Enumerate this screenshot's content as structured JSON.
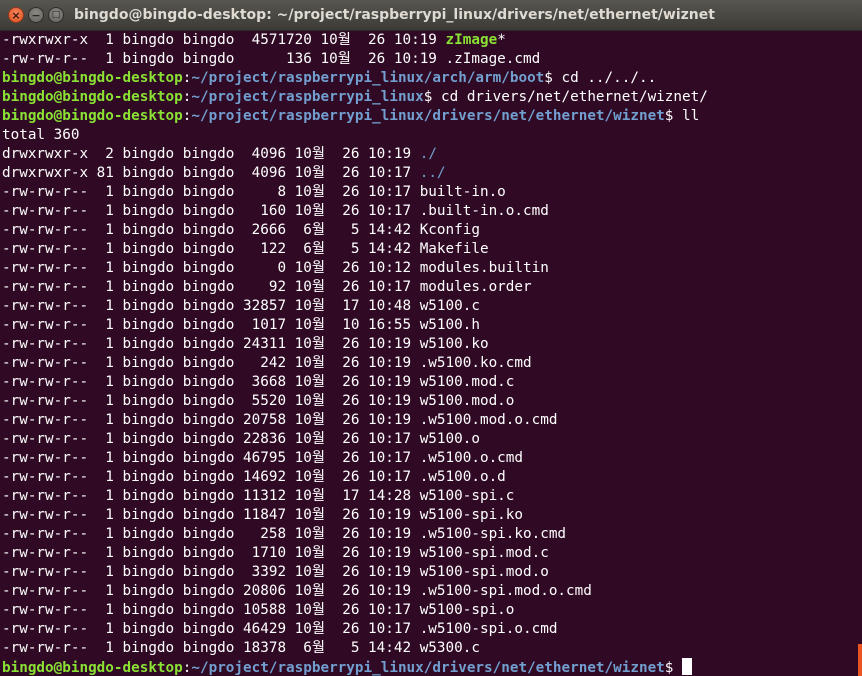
{
  "window": {
    "title": "bingdo@bingdo-desktop: ~/project/raspberrypi_linux/drivers/net/ethernet/wiznet",
    "close_glyph": "×",
    "min_glyph": "−",
    "max_glyph": "□"
  },
  "colors": {
    "background": "#300a24",
    "prompt_user": "#8ae234",
    "prompt_path": "#729fcf",
    "text": "#ffffff",
    "close_button": "#e0531f"
  },
  "terminal": {
    "lines": [
      [
        {
          "t": "-rwxrwxr-x  1 bingdo bingdo  4571720 10월  26 10:19 ",
          "c": "plain"
        },
        {
          "t": "zImage",
          "c": "exec"
        },
        {
          "t": "*",
          "c": "plain"
        }
      ],
      [
        {
          "t": "-rw-rw-r--  1 bingdo bingdo      136 10월  26 10:19 .zImage.cmd",
          "c": "plain"
        }
      ],
      [
        {
          "t": "bingdo@bingdo-desktop",
          "c": "user"
        },
        {
          "t": ":",
          "c": "plain"
        },
        {
          "t": "~/project/raspberrypi_linux/arch/arm/boot",
          "c": "path"
        },
        {
          "t": "$ cd ../../..",
          "c": "plain"
        }
      ],
      [
        {
          "t": "bingdo@bingdo-desktop",
          "c": "user"
        },
        {
          "t": ":",
          "c": "plain"
        },
        {
          "t": "~/project/raspberrypi_linux",
          "c": "path"
        },
        {
          "t": "$ cd drivers/net/ethernet/wiznet/",
          "c": "plain"
        }
      ],
      [
        {
          "t": "bingdo@bingdo-desktop",
          "c": "user"
        },
        {
          "t": ":",
          "c": "plain"
        },
        {
          "t": "~/project/raspberrypi_linux/drivers/net/ethernet/wiznet",
          "c": "path"
        },
        {
          "t": "$ ll",
          "c": "plain"
        }
      ],
      [
        {
          "t": "total 360",
          "c": "plain"
        }
      ],
      [
        {
          "t": "drwxrwxr-x  2 bingdo bingdo  4096 10월  26 10:19 ",
          "c": "plain"
        },
        {
          "t": "./",
          "c": "dir"
        }
      ],
      [
        {
          "t": "drwxrwxr-x 81 bingdo bingdo  4096 10월  26 10:17 ",
          "c": "plain"
        },
        {
          "t": "../",
          "c": "dir"
        }
      ],
      [
        {
          "t": "-rw-rw-r--  1 bingdo bingdo     8 10월  26 10:17 built-in.o",
          "c": "plain"
        }
      ],
      [
        {
          "t": "-rw-rw-r--  1 bingdo bingdo   160 10월  26 10:17 .built-in.o.cmd",
          "c": "plain"
        }
      ],
      [
        {
          "t": "-rw-rw-r--  1 bingdo bingdo  2666  6월   5 14:42 Kconfig",
          "c": "plain"
        }
      ],
      [
        {
          "t": "-rw-rw-r--  1 bingdo bingdo   122  6월   5 14:42 Makefile",
          "c": "plain"
        }
      ],
      [
        {
          "t": "-rw-rw-r--  1 bingdo bingdo     0 10월  26 10:12 modules.builtin",
          "c": "plain"
        }
      ],
      [
        {
          "t": "-rw-rw-r--  1 bingdo bingdo    92 10월  26 10:17 modules.order",
          "c": "plain"
        }
      ],
      [
        {
          "t": "-rw-rw-r--  1 bingdo bingdo 32857 10월  17 10:48 w5100.c",
          "c": "plain"
        }
      ],
      [
        {
          "t": "-rw-rw-r--  1 bingdo bingdo  1017 10월  10 16:55 w5100.h",
          "c": "plain"
        }
      ],
      [
        {
          "t": "-rw-rw-r--  1 bingdo bingdo 24311 10월  26 10:19 w5100.ko",
          "c": "plain"
        }
      ],
      [
        {
          "t": "-rw-rw-r--  1 bingdo bingdo   242 10월  26 10:19 .w5100.ko.cmd",
          "c": "plain"
        }
      ],
      [
        {
          "t": "-rw-rw-r--  1 bingdo bingdo  3668 10월  26 10:19 w5100.mod.c",
          "c": "plain"
        }
      ],
      [
        {
          "t": "-rw-rw-r--  1 bingdo bingdo  5520 10월  26 10:19 w5100.mod.o",
          "c": "plain"
        }
      ],
      [
        {
          "t": "-rw-rw-r--  1 bingdo bingdo 20758 10월  26 10:19 .w5100.mod.o.cmd",
          "c": "plain"
        }
      ],
      [
        {
          "t": "-rw-rw-r--  1 bingdo bingdo 22836 10월  26 10:17 w5100.o",
          "c": "plain"
        }
      ],
      [
        {
          "t": "-rw-rw-r--  1 bingdo bingdo 46795 10월  26 10:17 .w5100.o.cmd",
          "c": "plain"
        }
      ],
      [
        {
          "t": "-rw-rw-r--  1 bingdo bingdo 14692 10월  26 10:17 .w5100.o.d",
          "c": "plain"
        }
      ],
      [
        {
          "t": "-rw-rw-r--  1 bingdo bingdo 11312 10월  17 14:28 w5100-spi.c",
          "c": "plain"
        }
      ],
      [
        {
          "t": "-rw-rw-r--  1 bingdo bingdo 11847 10월  26 10:19 w5100-spi.ko",
          "c": "plain"
        }
      ],
      [
        {
          "t": "-rw-rw-r--  1 bingdo bingdo   258 10월  26 10:19 .w5100-spi.ko.cmd",
          "c": "plain"
        }
      ],
      [
        {
          "t": "-rw-rw-r--  1 bingdo bingdo  1710 10월  26 10:19 w5100-spi.mod.c",
          "c": "plain"
        }
      ],
      [
        {
          "t": "-rw-rw-r--  1 bingdo bingdo  3392 10월  26 10:19 w5100-spi.mod.o",
          "c": "plain"
        }
      ],
      [
        {
          "t": "-rw-rw-r--  1 bingdo bingdo 20806 10월  26 10:19 .w5100-spi.mod.o.cmd",
          "c": "plain"
        }
      ],
      [
        {
          "t": "-rw-rw-r--  1 bingdo bingdo 10588 10월  26 10:17 w5100-spi.o",
          "c": "plain"
        }
      ],
      [
        {
          "t": "-rw-rw-r--  1 bingdo bingdo 46429 10월  26 10:17 .w5100-spi.o.cmd",
          "c": "plain"
        }
      ],
      [
        {
          "t": "-rw-rw-r--  1 bingdo bingdo 18378  6월   5 14:42 w5300.c",
          "c": "plain"
        }
      ],
      [
        {
          "t": "bingdo@bingdo-desktop",
          "c": "user"
        },
        {
          "t": ":",
          "c": "plain"
        },
        {
          "t": "~/project/raspberrypi_linux/drivers/net/ethernet/wiznet",
          "c": "path"
        },
        {
          "t": "$ ",
          "c": "plain"
        }
      ]
    ]
  }
}
